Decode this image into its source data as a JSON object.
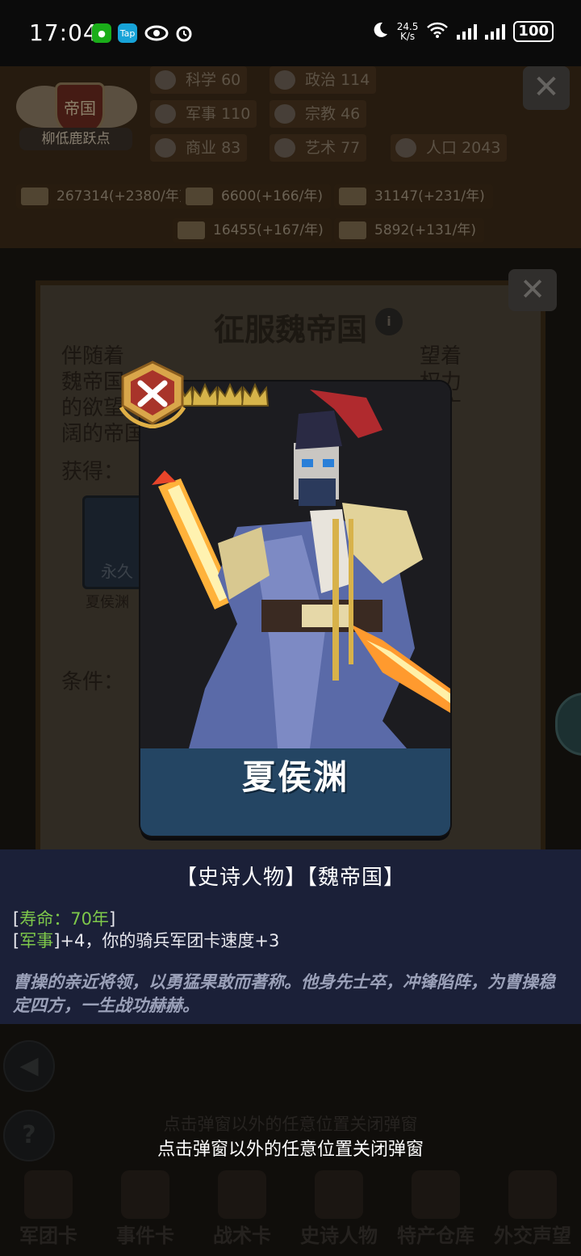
{
  "status": {
    "time": "17:04",
    "app_badge_1": "WeChat",
    "app_badge_2": "Tap",
    "speed_value": "24.5",
    "speed_unit": "K/s",
    "battery": "100"
  },
  "colors": {
    "accent_green": "#7ec84a",
    "name_bar": "#244563",
    "info_bg": "#1b2038"
  },
  "empire": {
    "emblem_text": "帝国",
    "name": "柳低鹿跃点",
    "stats": [
      {
        "label": "科学",
        "value": "60",
        "icon": "science-icon"
      },
      {
        "label": "政治",
        "value": "114",
        "icon": "politics-icon"
      },
      {
        "label": "军事",
        "value": "110",
        "icon": "military-icon"
      },
      {
        "label": "宗教",
        "value": "46",
        "icon": "religion-icon"
      },
      {
        "label": "商业",
        "value": "83",
        "icon": "commerce-icon"
      },
      {
        "label": "艺术",
        "value": "77",
        "icon": "art-icon"
      },
      {
        "label": "人口",
        "value": "2043",
        "icon": "population-icon"
      }
    ],
    "resources": [
      {
        "value": "267314(+2380/年)",
        "icon": "gold-icon"
      },
      {
        "value": "6600(+166/年)",
        "icon": "wood-icon"
      },
      {
        "value": "31147(+231/年)",
        "icon": "iron-icon"
      },
      {
        "value": "16455(+167/年)",
        "icon": "stone-icon"
      },
      {
        "value": "5892(+131/年)",
        "icon": "meat-icon"
      }
    ]
  },
  "quest_panel": {
    "title": "征服魏帝国",
    "text_lines": [
      "伴随着",
      "魏帝国",
      "的欲望",
      "阔的帝国"
    ],
    "text_right": [
      "望着",
      "权力",
      "片广"
    ],
    "obtain_label": "获得：",
    "reward_badge": "永久",
    "reward_name": "夏侯渊",
    "condition_label": "条件："
  },
  "card": {
    "name": "夏侯渊",
    "stars": 5
  },
  "info": {
    "title": "【史诗人物】【魏帝国】",
    "lifespan_open": "[",
    "lifespan": "寿命：70年",
    "lifespan_close": "]",
    "military_open": "[",
    "military_tag": "军事",
    "military_close": "]",
    "military_effect": "+4，你的骑兵军团卡速度+3",
    "description": "曹操的亲近将领，以勇猛果敢而著称。他身先士卒，冲锋陷阵，为曹操稳定四方，一生战功赫赫。"
  },
  "hint_dim": "点击弹窗以外的任意位置关闭弹窗",
  "hint": "点击弹窗以外的任意位置关闭弹窗",
  "bottom_nav": [
    {
      "label": "军团卡",
      "icon": "helmet-icon"
    },
    {
      "label": "事件卡",
      "icon": "scroll-icon"
    },
    {
      "label": "战术卡",
      "icon": "tactics-icon"
    },
    {
      "label": "史诗人物",
      "icon": "crown-icon"
    },
    {
      "label": "特产仓库",
      "icon": "chest-icon"
    },
    {
      "label": "外交声望",
      "icon": "envelope-icon"
    }
  ]
}
